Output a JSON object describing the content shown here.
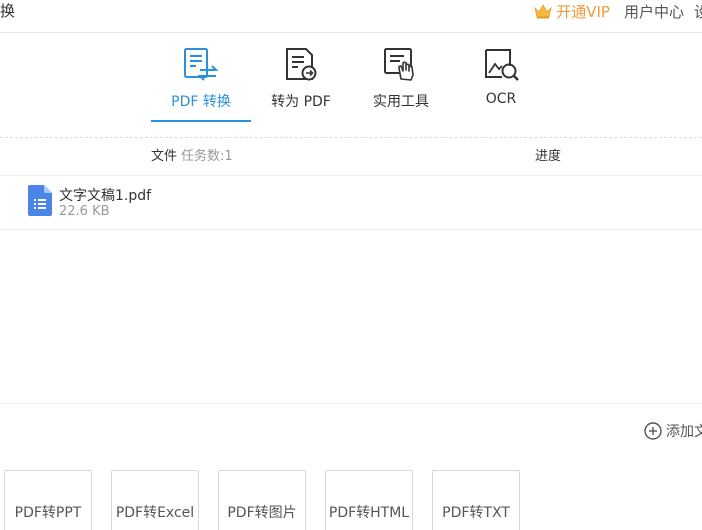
{
  "header": {
    "title_fragment": "换",
    "vip_label": "开通VIP",
    "user_center_label": "用户中心",
    "cutoff_char": "设"
  },
  "tabs": [
    {
      "label": "PDF 转换",
      "icon": "pdf-convert-icon",
      "active": true
    },
    {
      "label": "转为 PDF",
      "icon": "to-pdf-icon",
      "active": false
    },
    {
      "label": "实用工具",
      "icon": "tools-icon",
      "active": false
    },
    {
      "label": "OCR",
      "icon": "ocr-icon",
      "active": false
    }
  ],
  "table": {
    "col_file": "文件",
    "task_count": "任务数:1",
    "col_progress": "进度",
    "rows": [
      {
        "name": "文字文稿1.pdf",
        "size": "22.6 KB"
      }
    ]
  },
  "add_file_label": "添加文",
  "bottom_buttons": [
    {
      "label": "PDF转PPT"
    },
    {
      "label": "PDF转Excel"
    },
    {
      "label": "PDF转图片"
    },
    {
      "label": "PDF转HTML"
    },
    {
      "label": "PDF转TXT"
    }
  ],
  "colors": {
    "accent": "#2a90d9",
    "vip": "#f29a3d",
    "file_icon": "#4a86e8"
  }
}
